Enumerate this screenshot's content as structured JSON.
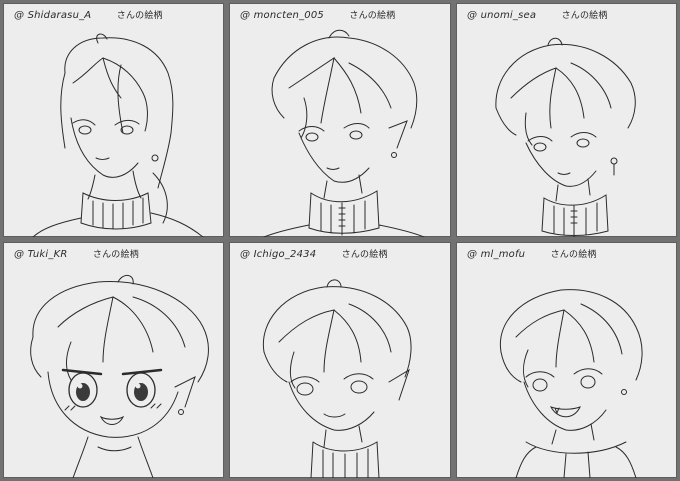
{
  "panels": [
    {
      "handle": "@ Shidarasu_A",
      "credit": "さんの絵柄",
      "illustration": "sketch-portrait"
    },
    {
      "handle": "@ moncten_005",
      "credit": "さんの絵柄",
      "illustration": "sketch-portrait"
    },
    {
      "handle": "@ unomi_sea",
      "credit": "さんの絵柄",
      "illustration": "sketch-portrait"
    },
    {
      "handle": "@ Tuki_KR",
      "credit": "さんの絵柄",
      "illustration": "sketch-portrait-chibi"
    },
    {
      "handle": "@ Ichigo_2434",
      "credit": "さんの絵柄",
      "illustration": "sketch-portrait"
    },
    {
      "handle": "@ ml_mofu",
      "credit": "さんの絵柄",
      "illustration": "sketch-portrait"
    }
  ],
  "colors": {
    "paper": "#ededed",
    "border": "#727272",
    "ink": "#2a2a2a"
  }
}
